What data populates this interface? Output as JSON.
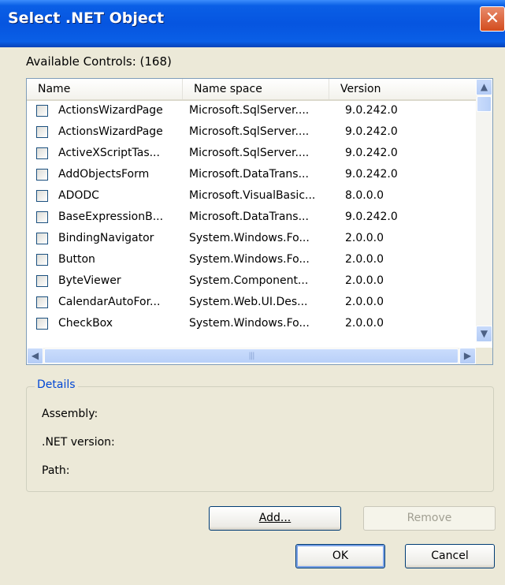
{
  "window": {
    "title": "Select .NET Object"
  },
  "available_label": "Available Controls: (168)",
  "columns": [
    "Name",
    "Name space",
    "Version"
  ],
  "rows": [
    {
      "name": "ActionsWizardPage",
      "namespace": "Microsoft.SqlServer....",
      "version": "9.0.242.0"
    },
    {
      "name": "ActionsWizardPage",
      "namespace": "Microsoft.SqlServer....",
      "version": "9.0.242.0"
    },
    {
      "name": "ActiveXScriptTas...",
      "namespace": "Microsoft.SqlServer....",
      "version": "9.0.242.0"
    },
    {
      "name": "AddObjectsForm",
      "namespace": "Microsoft.DataTrans...",
      "version": "9.0.242.0"
    },
    {
      "name": "ADODC",
      "namespace": "Microsoft.VisualBasic...",
      "version": "8.0.0.0"
    },
    {
      "name": "BaseExpressionB...",
      "namespace": "Microsoft.DataTrans...",
      "version": "9.0.242.0"
    },
    {
      "name": "BindingNavigator",
      "namespace": "System.Windows.Fo...",
      "version": "2.0.0.0"
    },
    {
      "name": "Button",
      "namespace": "System.Windows.Fo...",
      "version": "2.0.0.0"
    },
    {
      "name": "ByteViewer",
      "namespace": "System.Component...",
      "version": "2.0.0.0"
    },
    {
      "name": "CalendarAutoFor...",
      "namespace": "System.Web.UI.Des...",
      "version": "2.0.0.0"
    },
    {
      "name": "CheckBox",
      "namespace": "System.Windows.Fo...",
      "version": "2.0.0.0"
    }
  ],
  "details": {
    "legend": "Details",
    "assembly_label": "Assembly:",
    "net_version_label": ".NET version:",
    "path_label": "Path:"
  },
  "buttons": {
    "add": "Add...",
    "remove": "Remove",
    "ok": "OK",
    "cancel": "Cancel"
  },
  "icons": {
    "close": "close-icon",
    "scroll_up": "arrow-up-icon",
    "scroll_down": "arrow-down-icon",
    "scroll_left": "arrow-left-icon",
    "scroll_right": "arrow-right-icon"
  }
}
